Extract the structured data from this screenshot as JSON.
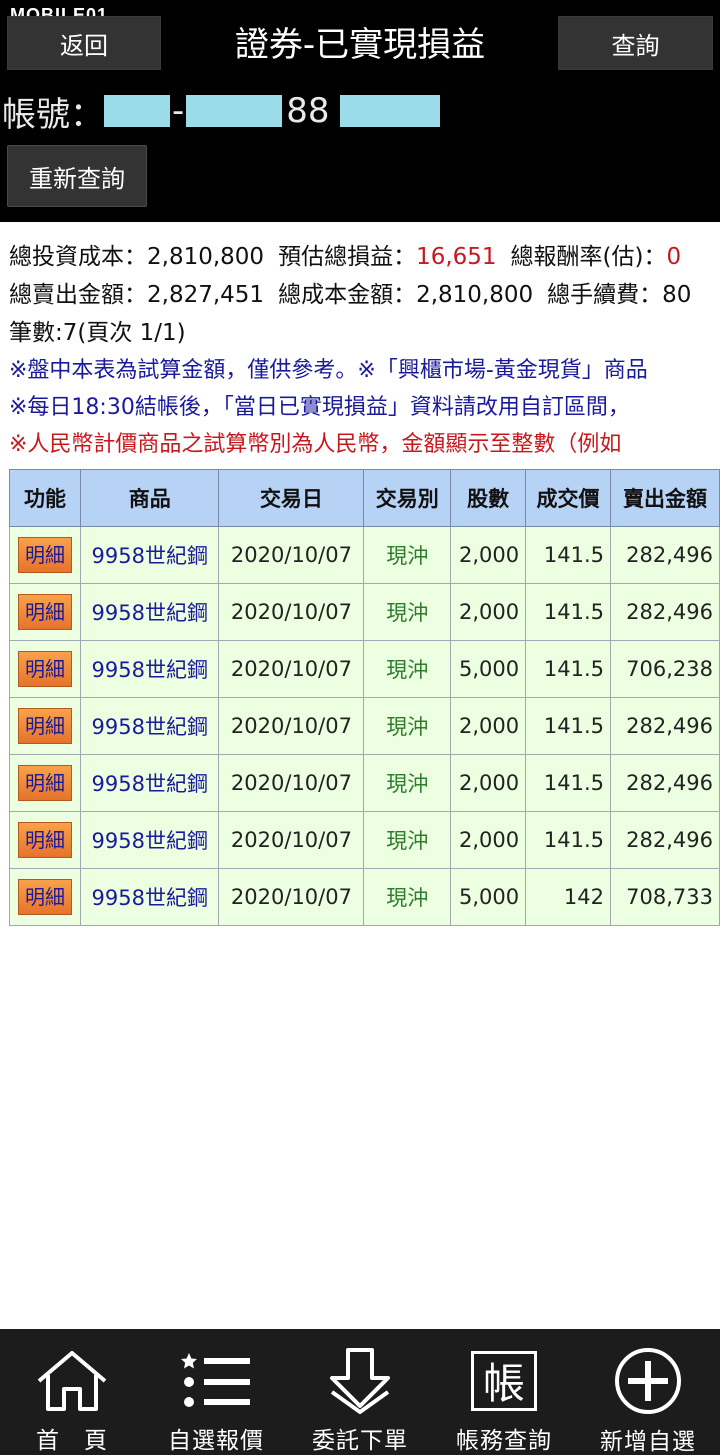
{
  "watermark": "MOBILE01",
  "header": {
    "back_label": "返回",
    "title": "證券-已實現損益",
    "query_label": "查詢",
    "account_label": "帳號：",
    "account_sep": "-",
    "account_visible_digits": "88",
    "requery_label": "重新查詢"
  },
  "summary": {
    "total_cost_label": "總投資成本：",
    "total_cost": "2,810,800",
    "est_pnl_label": "預估總損益：",
    "est_pnl": "16,651",
    "return_label": "總報酬率(估)：",
    "return_value": "0",
    "total_sell_label": "總賣出金額：",
    "total_sell": "2,827,451",
    "total_principal_label": "總成本金額：",
    "total_principal": "2,810,800",
    "total_fee_label": "總手續費：",
    "total_fee": "80",
    "count_text": "筆數:7(頁次 1/1)",
    "note1": "※盤中本表為試算金額，僅供參考。※「興櫃市場-黃金現貨」商品",
    "note2": "※每日18:30結帳後，「當日已實現損益」資料請改用自訂區間，",
    "note3": "※人民幣計價商品之試算幣別為人民幣，金額顯示至整數（例如",
    "accent_red": "#c8181e",
    "accent_blue": "#1a1a9c"
  },
  "table": {
    "headers": [
      "功能",
      "商品",
      "交易日",
      "交易別",
      "股數",
      "成交價",
      "賣出金額"
    ],
    "detail_label": "明細",
    "rows": [
      {
        "product": "9958世紀鋼",
        "date": "2020/10/07",
        "type": "現沖",
        "shares": "2,000",
        "price": "141.5",
        "amount": "282,496"
      },
      {
        "product": "9958世紀鋼",
        "date": "2020/10/07",
        "type": "現沖",
        "shares": "2,000",
        "price": "141.5",
        "amount": "282,496"
      },
      {
        "product": "9958世紀鋼",
        "date": "2020/10/07",
        "type": "現沖",
        "shares": "5,000",
        "price": "141.5",
        "amount": "706,238"
      },
      {
        "product": "9958世紀鋼",
        "date": "2020/10/07",
        "type": "現沖",
        "shares": "2,000",
        "price": "141.5",
        "amount": "282,496"
      },
      {
        "product": "9958世紀鋼",
        "date": "2020/10/07",
        "type": "現沖",
        "shares": "2,000",
        "price": "141.5",
        "amount": "282,496"
      },
      {
        "product": "9958世紀鋼",
        "date": "2020/10/07",
        "type": "現沖",
        "shares": "2,000",
        "price": "141.5",
        "amount": "282,496"
      },
      {
        "product": "9958世紀鋼",
        "date": "2020/10/07",
        "type": "現沖",
        "shares": "5,000",
        "price": "142",
        "amount": "708,733"
      }
    ]
  },
  "nav": {
    "items": [
      {
        "label": "首　頁",
        "icon": "home-icon"
      },
      {
        "label": "自選報價",
        "icon": "watchlist-icon"
      },
      {
        "label": "委託下單",
        "icon": "order-download-icon"
      },
      {
        "label": "帳務查詢",
        "icon": "account-ledger-icon",
        "icon_char": "帳"
      },
      {
        "label": "新增自選",
        "icon": "add-circle-icon"
      }
    ]
  }
}
